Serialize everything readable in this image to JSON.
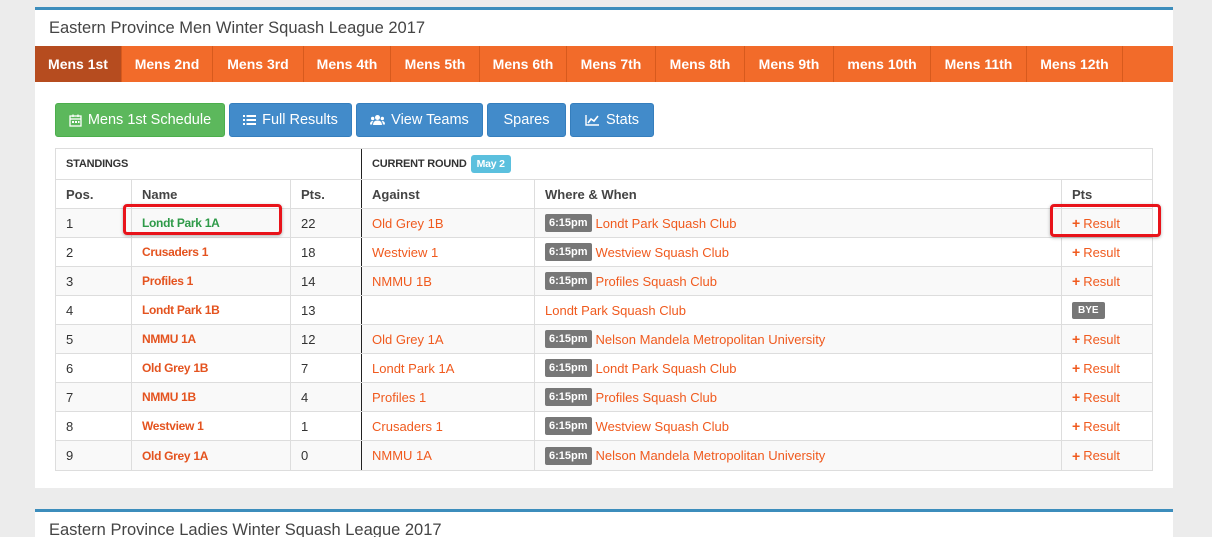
{
  "main_title": "Eastern Province Men Winter Squash League 2017",
  "ladies_title": "Eastern Province Ladies Winter Squash League 2017",
  "league_tabs": [
    "Mens 1st",
    "Mens 2nd",
    "Mens 3rd",
    "Mens 4th",
    "Mens 5th",
    "Mens 6th",
    "Mens 7th",
    "Mens 8th",
    "Mens 9th",
    "mens 10th",
    "Mens 11th",
    "Mens 12th"
  ],
  "active_tab": "Mens 1st",
  "buttons": {
    "schedule": "Mens 1st Schedule",
    "full_results": "Full Results",
    "view_teams": "View Teams",
    "spares": "Spares",
    "stats": "Stats"
  },
  "headers": {
    "standings": "STANDINGS",
    "current_round": "CURRENT ROUND",
    "round_badge": "May 2",
    "pos": "Pos.",
    "name": "Name",
    "pts": "Pts.",
    "against": "Against",
    "where_when": "Where & When",
    "result_pts": "Pts"
  },
  "result_label": "Result",
  "bye_label": "BYE",
  "rows": [
    {
      "pos": "1",
      "name": "Londt Park 1A",
      "pts": "22",
      "against": "Old Grey 1B",
      "time": "6:15pm",
      "venue": "Londt Park Squash Club"
    },
    {
      "pos": "2",
      "name": "Crusaders 1",
      "pts": "18",
      "against": "Westview 1",
      "time": "6:15pm",
      "venue": "Westview Squash Club"
    },
    {
      "pos": "3",
      "name": "Profiles 1",
      "pts": "14",
      "against": "NMMU 1B",
      "time": "6:15pm",
      "venue": "Profiles Squash Club"
    },
    {
      "pos": "4",
      "name": "Londt Park 1B",
      "pts": "13",
      "against": "",
      "time": "",
      "venue": "Londt Park Squash Club"
    },
    {
      "pos": "5",
      "name": "NMMU 1A",
      "pts": "12",
      "against": "Old Grey 1A",
      "time": "6:15pm",
      "venue": "Nelson Mandela Metropolitan University"
    },
    {
      "pos": "6",
      "name": "Old Grey 1B",
      "pts": "7",
      "against": "Londt Park 1A",
      "time": "6:15pm",
      "venue": "Londt Park Squash Club"
    },
    {
      "pos": "7",
      "name": "NMMU 1B",
      "pts": "4",
      "against": "Profiles 1",
      "time": "6:15pm",
      "venue": "Profiles Squash Club"
    },
    {
      "pos": "8",
      "name": "Westview 1",
      "pts": "1",
      "against": "Crusaders 1",
      "time": "6:15pm",
      "venue": "Westview Squash Club"
    },
    {
      "pos": "9",
      "name": "Old Grey 1A",
      "pts": "0",
      "against": "NMMU 1A",
      "time": "6:15pm",
      "venue": "Nelson Mandela Metropolitan University"
    }
  ]
}
